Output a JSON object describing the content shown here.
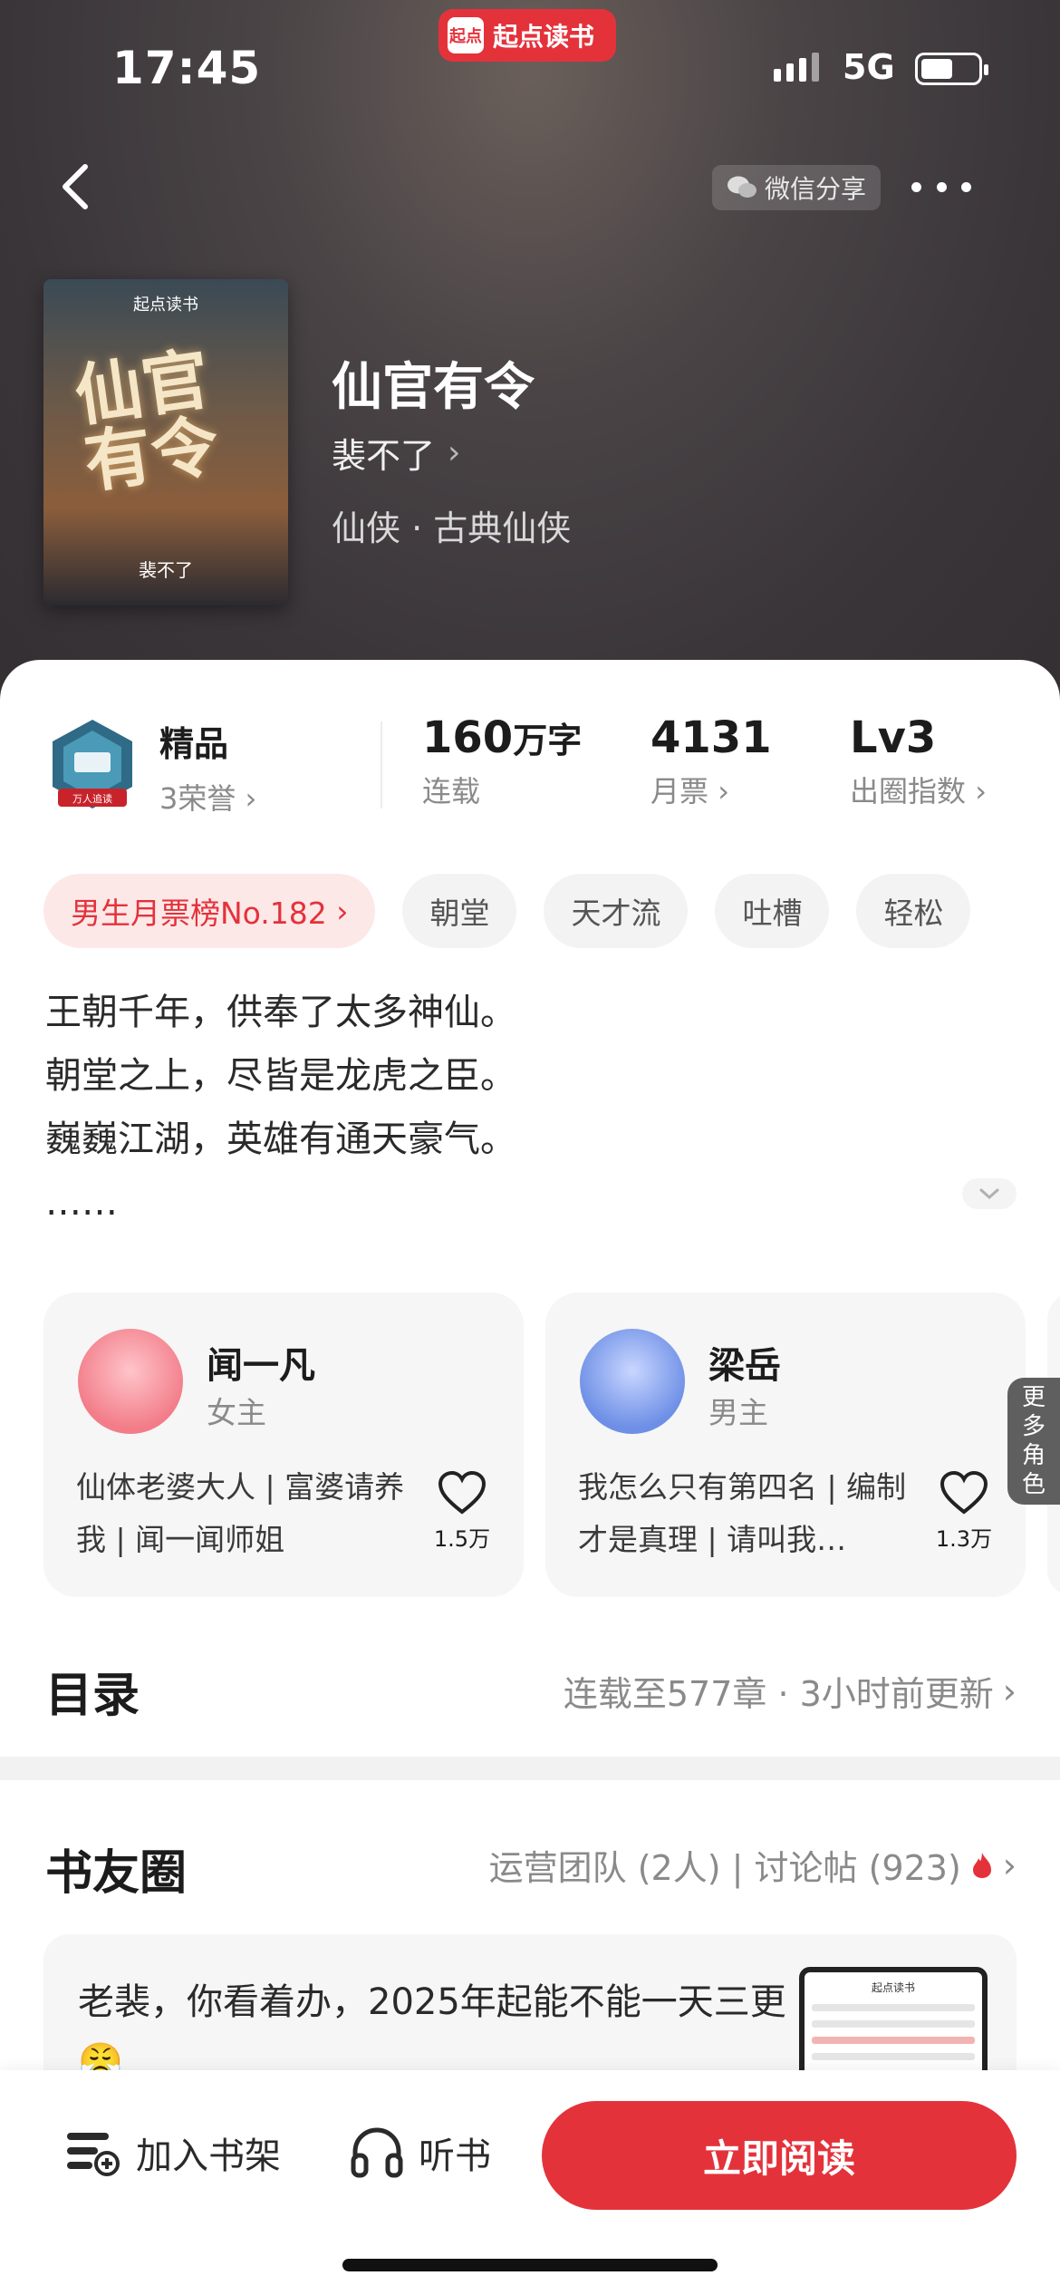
{
  "status_bar": {
    "time": "17:45",
    "network": "5G"
  },
  "app_badge": {
    "logo": "起点",
    "name": "起点读书"
  },
  "nav": {
    "share_label": "微信分享",
    "share_icon": "wechat-icon",
    "back_icon": "chevron-left-icon",
    "more_icon": "more-dots-icon"
  },
  "book": {
    "cover_brand": "起点读书",
    "cover_title": "仙官有令",
    "cover_author": "裴不了",
    "title": "仙官有令",
    "author": "裴不了",
    "genre": "仙侠 · 古典仙侠"
  },
  "stats": {
    "medal": {
      "badge_text": "万人追读",
      "title": "精品",
      "sub": "3荣誉"
    },
    "words": {
      "value": "160",
      "unit": "万字",
      "label": "连载"
    },
    "monthly_votes": {
      "value": "4131",
      "label": "月票"
    },
    "popularity": {
      "value": "Lv3",
      "label": "出圈指数"
    }
  },
  "tags": [
    "男生月票榜No.182",
    "朝堂",
    "天才流",
    "吐槽",
    "轻松"
  ],
  "intro": [
    "王朝千年，供奉了太多神仙。",
    "朝堂之上，尽皆是龙虎之臣。",
    "巍巍江湖，英雄有通天豪气。",
    "……"
  ],
  "roles": [
    {
      "name": "闻一凡",
      "role": "女主",
      "desc": "仙体老婆大人 | 富婆请养我 | 闻一闻师姐",
      "likes": "1.5万",
      "avatar_color": "#f07a86"
    },
    {
      "name": "梁岳",
      "role": "男主",
      "desc": "我怎么只有第四名 | 编制才是真理 | 请叫我…",
      "likes": "1.3万",
      "avatar_color": "#6d8fe6"
    }
  ],
  "more_roles": [
    "更",
    "多",
    "角",
    "色"
  ],
  "catalog": {
    "title": "目录",
    "info": "连载至577章 · 3小时前更新"
  },
  "circle": {
    "title": "书友圈",
    "info": "运营团队 (2人) | 讨论帖 (923)",
    "post_text": "老裴，你看着办，2025年起能不能一天三更😤",
    "thumb_head": "起点读书"
  },
  "bottom_bar": {
    "shelf_label": "加入书架",
    "listen_label": "听书",
    "read_label": "立即阅读"
  },
  "colors": {
    "accent": "#e4323b",
    "hero_bg": "#3a3539"
  }
}
